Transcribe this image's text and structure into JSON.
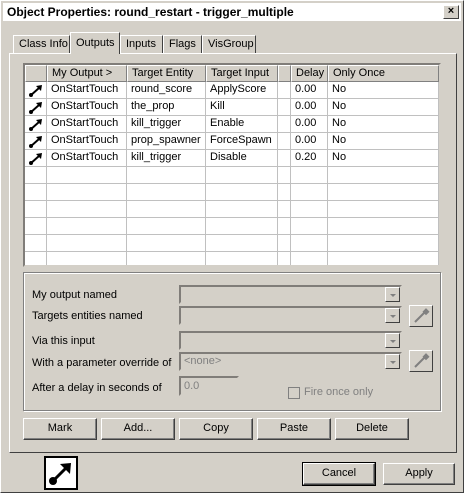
{
  "window": {
    "title": "Object Properties: round_restart - trigger_multiple",
    "close_glyph": "×"
  },
  "tabs": [
    {
      "label": "Class Info"
    },
    {
      "label": "Outputs"
    },
    {
      "label": "Inputs"
    },
    {
      "label": "Flags"
    },
    {
      "label": "VisGroup"
    }
  ],
  "outputs_list": {
    "columns": [
      "",
      "My Output >",
      "Target Entity",
      "Target Input",
      "",
      "Delay",
      "Only Once"
    ],
    "rows": [
      {
        "icon": "output-connection-icon",
        "output": "OnStartTouch",
        "target": "round_score",
        "input": "ApplyScore",
        "delay": "0.00",
        "once": "No"
      },
      {
        "icon": "output-connection-icon",
        "output": "OnStartTouch",
        "target": "the_prop",
        "input": "Kill",
        "delay": "0.00",
        "once": "No"
      },
      {
        "icon": "output-connection-icon",
        "output": "OnStartTouch",
        "target": "kill_trigger",
        "input": "Enable",
        "delay": "0.00",
        "once": "No"
      },
      {
        "icon": "output-connection-icon",
        "output": "OnStartTouch",
        "target": "prop_spawner",
        "input": "ForceSpawn",
        "delay": "0.00",
        "once": "No"
      },
      {
        "icon": "output-connection-icon",
        "output": "OnStartTouch",
        "target": "kill_trigger",
        "input": "Disable",
        "delay": "0.20",
        "once": "No"
      }
    ]
  },
  "form": {
    "my_output_label": "My output named",
    "targets_label": "Targets entities named",
    "via_input_label": "Via this input",
    "parameter_label": "With a parameter override of",
    "parameter_value": "<none>",
    "delay_label": "After a delay in seconds of",
    "delay_value": "0.0",
    "fire_once_label": "Fire once only"
  },
  "actions": {
    "mark": "Mark",
    "add": "Add...",
    "copy": "Copy",
    "paste": "Paste",
    "delete": "Delete"
  },
  "footer": {
    "cancel": "Cancel",
    "apply": "Apply"
  }
}
